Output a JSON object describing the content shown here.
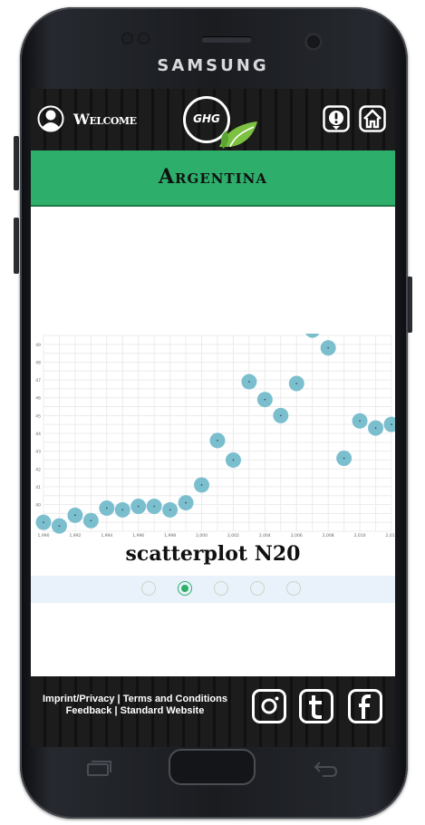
{
  "device": {
    "brand": "SAMSUNG"
  },
  "header": {
    "welcome_label": "Welcome",
    "logo_text": "GHG",
    "icons": [
      "user-icon",
      "alert-icon",
      "home-icon"
    ]
  },
  "page": {
    "country": "Argentina"
  },
  "chart_data": {
    "type": "scatter",
    "caption": "scatterplot N20",
    "x": [
      1990,
      1991,
      1992,
      1993,
      1994,
      1995,
      1996,
      1997,
      1998,
      1999,
      2000,
      2001,
      2002,
      2003,
      2004,
      2005,
      2006,
      2007,
      2008,
      2009,
      2010,
      2011,
      2012
    ],
    "y": [
      39.0,
      38.8,
      39.4,
      39.1,
      39.8,
      39.7,
      39.9,
      39.9,
      39.7,
      40.1,
      41.1,
      43.6,
      42.5,
      46.9,
      45.9,
      45.0,
      46.8,
      49.8,
      48.8,
      42.6,
      44.7,
      44.3,
      44.5
    ],
    "x_ticks": [
      "1,990",
      "1,992",
      "1,994",
      "1,996",
      "1,998",
      "2,000",
      "2,002",
      "2,004",
      "2,006",
      "2,008",
      "2,010",
      "2,012"
    ],
    "y_ticks": [
      "39",
      "40",
      "41",
      "42",
      "43",
      "44",
      "45",
      "46",
      "47",
      "48",
      "49"
    ],
    "xlim": [
      1990,
      2012
    ],
    "ylim": [
      38.5,
      49.5
    ],
    "grid": true
  },
  "pager": {
    "count": 5,
    "active": 1
  },
  "footer": {
    "imprint": "Imprint/Privacy",
    "terms": "Terms and Conditions",
    "feedback": "Feedback",
    "standard": "Standard Website",
    "sep": "|",
    "social": [
      "instagram-icon",
      "tumblr-icon",
      "facebook-icon"
    ]
  },
  "colors": {
    "green": "#2daf6b",
    "dot": "#7bbfcf"
  }
}
